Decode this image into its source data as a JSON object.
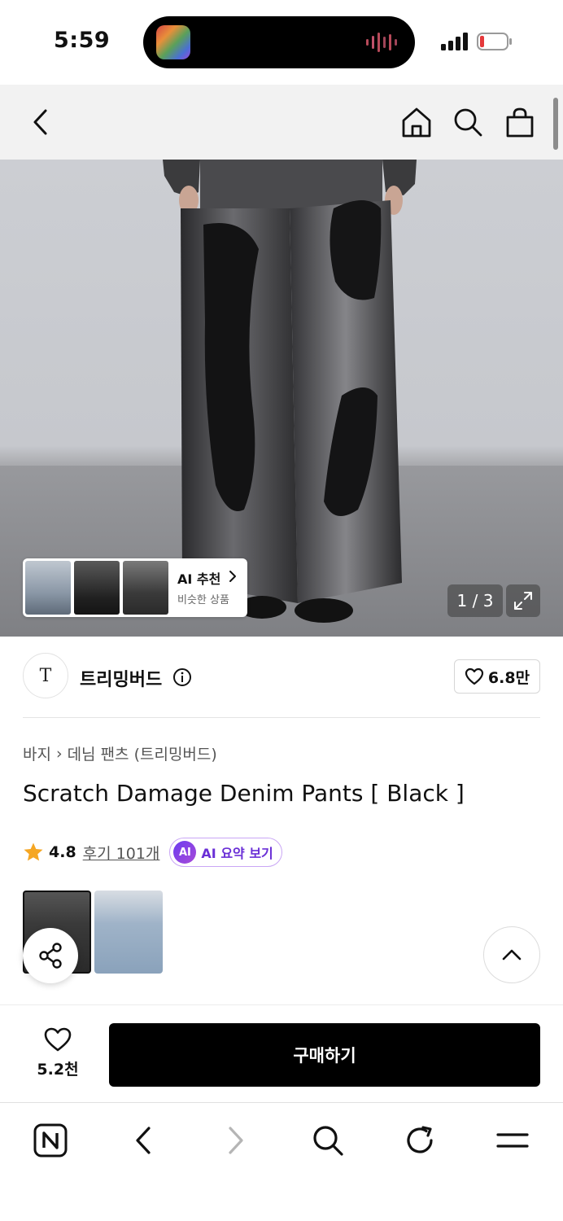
{
  "status_bar": {
    "time": "5:59"
  },
  "gallery": {
    "counter": "1 / 3",
    "ai_recommend": {
      "label": "AI 추천",
      "sub": "비슷한 상품"
    }
  },
  "brand": {
    "logo_text": "T",
    "name": "트리밍버드",
    "likes": "6.8만"
  },
  "breadcrumb": {
    "category": "바지",
    "separator": "›",
    "subcategory": "데님 팬츠 (트리밍버드)"
  },
  "product": {
    "title": "Scratch Damage Denim Pants [ Black ]",
    "rating": "4.8",
    "reviews": "후기 101개",
    "ai_badge": "AI",
    "ai_summary": "AI 요약 보기"
  },
  "purchase": {
    "wish_count": "5.2천",
    "buy_label": "구매하기"
  },
  "colors": {
    "star": "#f5a623",
    "ai_purple": "#6a2fd6",
    "buy_button": "#000000"
  },
  "icons": [
    "back-icon",
    "home-icon",
    "search-icon",
    "bag-icon",
    "chevron-right-icon",
    "expand-icon",
    "info-icon",
    "heart-icon",
    "star-icon",
    "share-icon",
    "chevron-up-icon",
    "naver-icon",
    "forward-icon",
    "refresh-icon",
    "menu-icon"
  ]
}
